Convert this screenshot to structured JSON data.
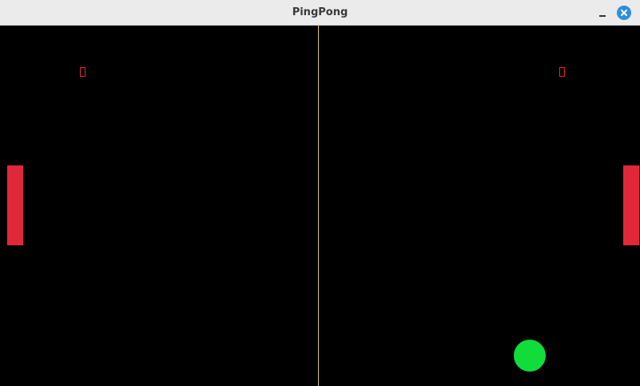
{
  "window": {
    "title": "PingPong"
  },
  "colors": {
    "background": "#000000",
    "paddle": "#e0283a",
    "score": "#e0283a",
    "center_line": "#d9c95a",
    "ball": "#10dd3a",
    "close_button": "#2d8fdc"
  },
  "icons": {
    "minimize": "minimize-icon",
    "close": "close-icon"
  },
  "game": {
    "score_left": "0",
    "score_right": "0"
  }
}
